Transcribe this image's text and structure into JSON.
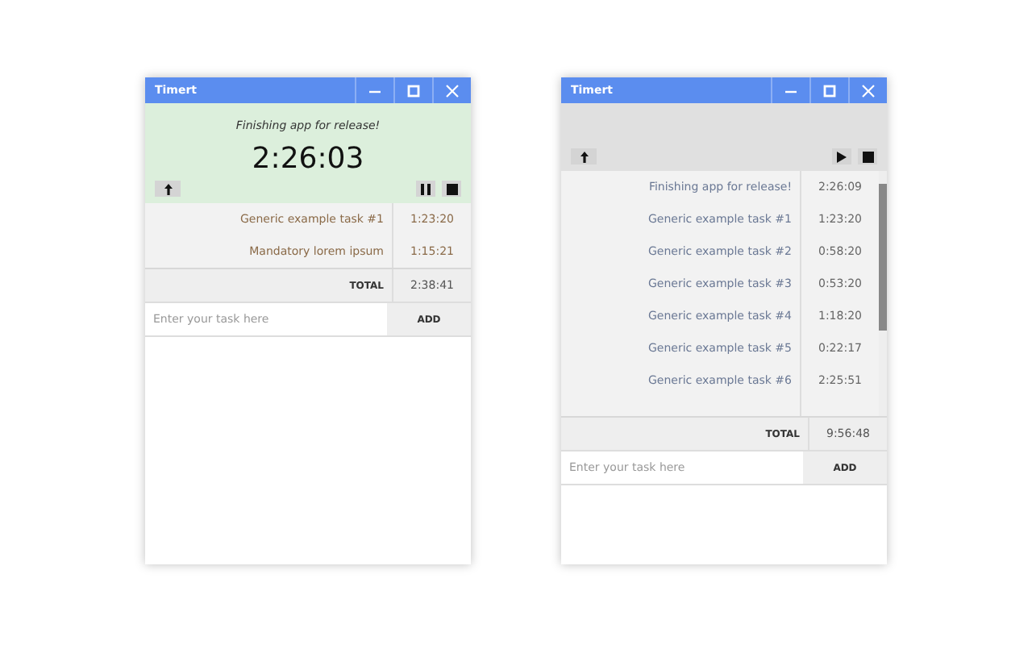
{
  "windows": [
    {
      "title": "Timert",
      "running": true,
      "current_task": "Finishing app for release!",
      "timer": "2:26:03",
      "scrollable": false,
      "tasks": [
        {
          "name": "Generic example task #1",
          "time": "1:23:20"
        },
        {
          "name": "Mandatory lorem ipsum",
          "time": "1:15:21"
        }
      ],
      "total_label": "TOTAL",
      "total": "2:38:41",
      "placeholder": "Enter your task here",
      "add_label": "ADD"
    },
    {
      "title": "Timert",
      "running": false,
      "scrollable": true,
      "tasks": [
        {
          "name": "Finishing app for release!",
          "time": "2:26:09"
        },
        {
          "name": "Generic example task #1",
          "time": "1:23:20"
        },
        {
          "name": "Generic example task #2",
          "time": "0:58:20"
        },
        {
          "name": "Generic example task #3",
          "time": "0:53:20"
        },
        {
          "name": "Generic example task #4",
          "time": "1:18:20"
        },
        {
          "name": "Generic example task #5",
          "time": "0:22:17"
        },
        {
          "name": "Generic example task #6",
          "time": "2:25:51"
        }
      ],
      "total_label": "TOTAL",
      "total": "9:56:48",
      "placeholder": "Enter your task here",
      "add_label": "ADD"
    }
  ]
}
